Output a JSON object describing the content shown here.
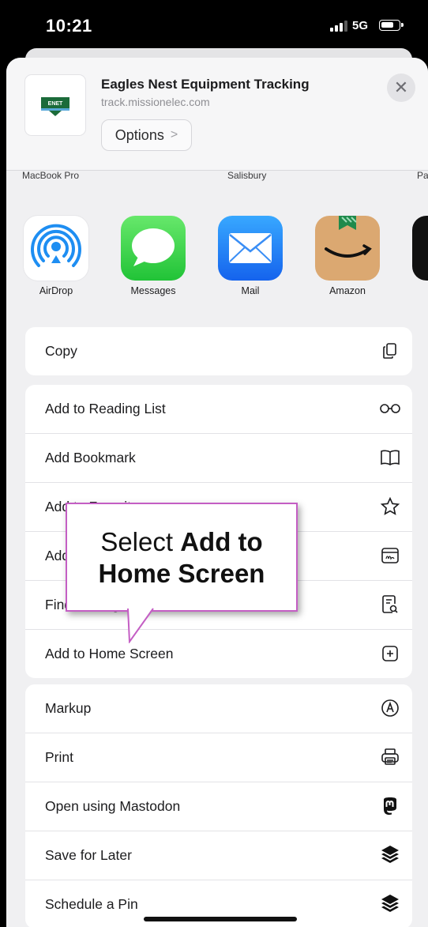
{
  "status_bar": {
    "time": "10:21",
    "network": "5G",
    "signal_bars": 3,
    "battery_level": 0.75
  },
  "share_header": {
    "site_title": "Eagles Nest Equipment Tracking",
    "site_url": "track.missionelec.com",
    "options_label": "Options",
    "options_chevron": ">",
    "close_symbol": "✕",
    "thumbnail_icon": "site-logo-icon"
  },
  "airdrop_people": [
    "MacBook Pro",
    "Salisbury",
    "Pa"
  ],
  "apps": [
    {
      "label": "AirDrop",
      "icon": "airdrop-icon"
    },
    {
      "label": "Messages",
      "icon": "messages-icon"
    },
    {
      "label": "Mail",
      "icon": "mail-icon"
    },
    {
      "label": "Amazon",
      "icon": "amazon-icon"
    },
    {
      "label": "",
      "icon": "app-icon"
    }
  ],
  "actions_group1": [
    {
      "label": "Copy",
      "icon": "copy-icon"
    }
  ],
  "actions_group2": [
    {
      "label": "Add to Reading List",
      "icon": "glasses-icon"
    },
    {
      "label": "Add Bookmark",
      "icon": "book-icon"
    },
    {
      "label": "Add to Favorites",
      "icon": "star-icon"
    },
    {
      "label": "Add to Quick Note",
      "icon": "quick-note-icon"
    },
    {
      "label": "Find on Page",
      "icon": "find-on-page-icon"
    },
    {
      "label": "Add to Home Screen",
      "icon": "add-square-icon"
    }
  ],
  "actions_group3": [
    {
      "label": "Markup",
      "icon": "markup-icon"
    },
    {
      "label": "Print",
      "icon": "printer-icon"
    },
    {
      "label": "Open using Mastodon",
      "icon": "mastodon-icon"
    },
    {
      "label": "Save for Later",
      "icon": "layers-icon"
    },
    {
      "label": "Schedule a Pin",
      "icon": "layers-icon"
    }
  ],
  "callout": {
    "text_plain": "Select ",
    "text_bold_1": "Add to",
    "text_bold_2": "Home Screen"
  },
  "colors": {
    "callout_border": "#c45ec4",
    "sheet_bg": "#f0f0f2",
    "row_bg": "#ffffff"
  }
}
